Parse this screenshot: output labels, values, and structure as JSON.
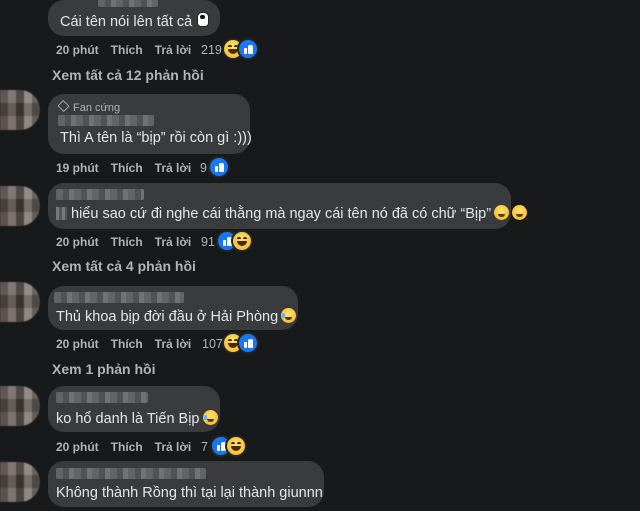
{
  "comments": [
    {
      "text": "Cái tên nói lên tất cả",
      "time": "20 phút",
      "like": "Thích",
      "reply": "Trả lời",
      "count": "219",
      "reactions": [
        "haha-icon",
        "like-icon"
      ],
      "view_more": "Xem tất cả 12 phản hồi"
    },
    {
      "badge": "Fan cứng",
      "text": "Thì A tên là “bịp” rồi còn gì :)))",
      "time": "19 phút",
      "like": "Thích",
      "reply": "Trả lời",
      "count": "9",
      "reactions": [
        "like-icon"
      ]
    },
    {
      "text": "hiểu sao cứ đi nghe cái thằng mà ngay cái tên nó đã có chữ “Bịp”",
      "time": "20 phút",
      "like": "Thích",
      "reply": "Trả lời",
      "count": "91",
      "reactions": [
        "like-icon",
        "haha-icon"
      ],
      "view_more": "Xem tất cả 4 phản hồi"
    },
    {
      "text": "Thủ khoa bịp đời đầu ở Hải Phòng",
      "time": "20 phút",
      "like": "Thích",
      "reply": "Trả lời",
      "count": "107",
      "reactions": [
        "haha-icon",
        "like-icon"
      ],
      "view_more": "Xem 1 phản hồi"
    },
    {
      "text": "ko hổ danh là Tiến Bịp",
      "time": "20 phút",
      "like": "Thích",
      "reply": "Trả lời",
      "count": "7",
      "reactions": [
        "like-icon",
        "haha-icon"
      ]
    },
    {
      "text": "Không thành Rồng thì tại lại thành giunnn"
    }
  ]
}
